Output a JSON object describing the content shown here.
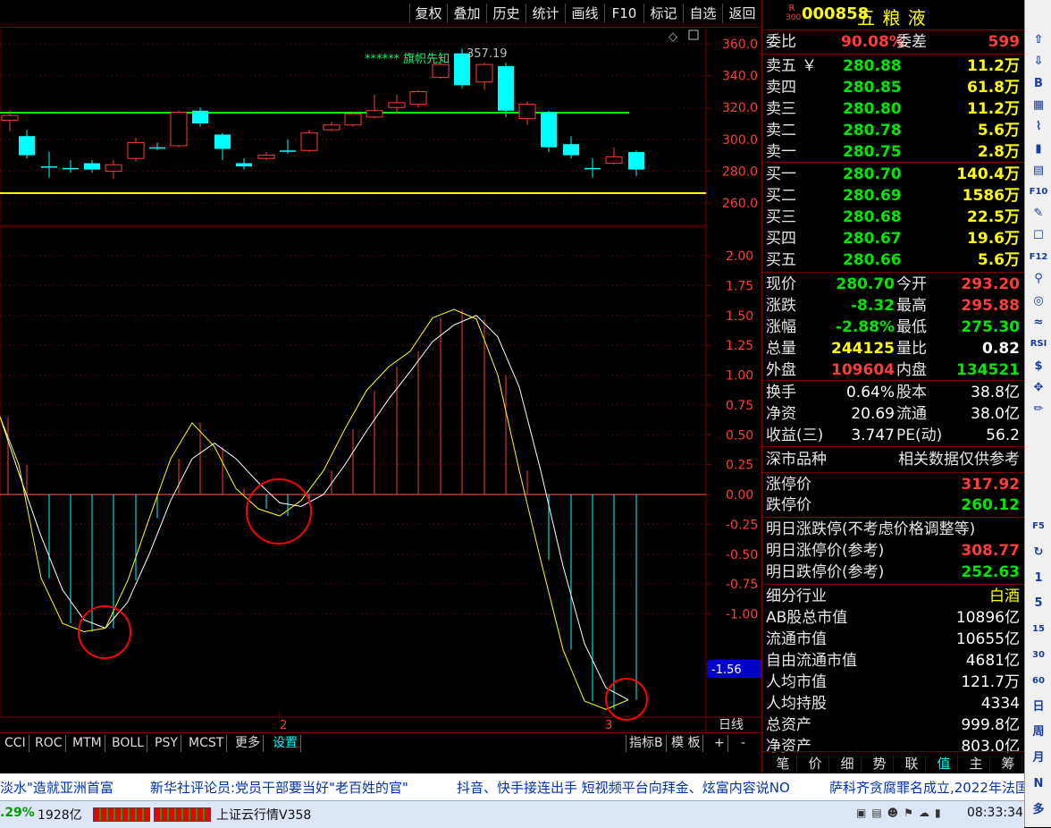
{
  "toolbar": {
    "buttons": [
      "复权",
      "叠加",
      "历史",
      "统计",
      "画线",
      "F10",
      "标记",
      "自选",
      "返回"
    ]
  },
  "price_axis": {
    "labels": [
      "360.0",
      "340.0",
      "320.0",
      "300.0",
      "280.0",
      "260.0"
    ],
    "annotation_high": "357.19",
    "annotation_flag": "****** 旗帜先知"
  },
  "indicator_axis": {
    "labels": [
      "2.00",
      "1.75",
      "1.50",
      "1.25",
      "1.00",
      "0.75",
      "0.50",
      "0.25",
      "0.00",
      "-0.25",
      "-0.50",
      "-0.75",
      "-1.00"
    ],
    "current_value": "-1.56"
  },
  "date_markers": {
    "m2": "2",
    "m3": "3"
  },
  "period_label": "日线",
  "indicator_tabs": [
    "CCI",
    "ROC",
    "MTM",
    "BOLL",
    "PSY",
    "MCST",
    "更多",
    "设置"
  ],
  "right_tabs": {
    "indicator": "指标B",
    "template": "模 板",
    "plus": "+",
    "minus": "-"
  },
  "stock": {
    "badge_top": "R",
    "badge_bottom": "300",
    "code": "000858",
    "name": "五 粮 液"
  },
  "quote": {
    "weibi_label": "委比",
    "weibi_value": "90.08%",
    "weicha_label": "委差",
    "weicha_value": "599",
    "asks": [
      {
        "label": "卖五",
        "price": "280.88",
        "vol": "11.2万"
      },
      {
        "label": "卖四",
        "price": "280.85",
        "vol": "61.8万"
      },
      {
        "label": "卖三",
        "price": "280.80",
        "vol": "11.2万"
      },
      {
        "label": "卖二",
        "price": "280.78",
        "vol": "5.6万"
      },
      {
        "label": "卖一",
        "price": "280.75",
        "vol": "2.8万"
      }
    ],
    "bids": [
      {
        "label": "买一",
        "price": "280.70",
        "vol": "140.4万"
      },
      {
        "label": "买二",
        "price": "280.69",
        "vol": "1586万"
      },
      {
        "label": "买三",
        "price": "280.68",
        "vol": "22.5万"
      },
      {
        "label": "买四",
        "price": "280.67",
        "vol": "19.6万"
      },
      {
        "label": "买五",
        "price": "280.66",
        "vol": "5.6万"
      }
    ],
    "stats": [
      {
        "l1": "现价",
        "v1": "280.70",
        "l2": "今开",
        "v2": "293.20"
      },
      {
        "l1": "涨跌",
        "v1": "-8.32",
        "l2": "最高",
        "v2": "295.88"
      },
      {
        "l1": "涨幅",
        "v1": "-2.88%",
        "l2": "最低",
        "v2": "275.30"
      },
      {
        "l1": "总量",
        "v1": "244125",
        "l2": "量比",
        "v2": "0.82"
      },
      {
        "l1": "外盘",
        "v1": "109604",
        "l2": "内盘",
        "v2": "134521"
      }
    ],
    "fund": [
      {
        "l1": "换手",
        "v1": "0.64%",
        "l2": "股本",
        "v2": "38.8亿"
      },
      {
        "l1": "净资",
        "v1": "20.69",
        "l2": "流通",
        "v2": "38.0亿"
      },
      {
        "l1": "收益(三)",
        "v1": "3.747",
        "l2": "PE(动)",
        "v2": "56.2"
      }
    ],
    "market_label": "深市品种",
    "market_note": "相关数据仅供参考",
    "limit_up_label": "涨停价",
    "limit_up": "317.92",
    "limit_down_label": "跌停价",
    "limit_down": "260.12",
    "next_title": "明日涨跌停(不考虑价格调整等)",
    "next_up_label": "明日涨停价(参考)",
    "next_up": "308.77",
    "next_down_label": "明日跌停价(参考)",
    "next_down": "252.63",
    "industry_label": "细分行业",
    "industry": "白酒",
    "values": [
      {
        "label": "AB股总市值",
        "value": "10896亿"
      },
      {
        "label": "流通市值",
        "value": "10655亿"
      },
      {
        "label": "自由流通市值",
        "value": "4681亿"
      },
      {
        "label": "人均市值",
        "value": "121.7万"
      },
      {
        "label": "人均持股",
        "value": "4334"
      },
      {
        "label": "总资产",
        "value": "999.8亿"
      },
      {
        "label": "净资产",
        "value": "803.0亿"
      }
    ],
    "sub_tabs": [
      "笔",
      "价",
      "细",
      "势",
      "联",
      "值",
      "主",
      "筹"
    ]
  },
  "sidebar_icons": [
    "⇧",
    "⇩",
    "B",
    "▦",
    "⌇",
    "▮",
    "▤",
    "F10",
    "✎",
    "☐",
    "F12",
    "⚲",
    "◎",
    "≈",
    "RSI",
    "$",
    "✥",
    "✏",
    "F5",
    "↻",
    "1",
    "5",
    "15",
    "30",
    "60",
    "日",
    "周",
    "月",
    "N",
    "多"
  ],
  "news": [
    "淡水\"造就亚洲首富",
    "新华社评论员:党员干部要当好\"老百姓的官\"",
    "抖音、快手接连出手 短视频平台向拜金、炫富内容说NO",
    "萨科齐贪腐罪名成立,2022年法国"
  ],
  "status": {
    "change": ".29%",
    "amount": "1928亿",
    "service": "上证云行情V358",
    "time": "08:33:34"
  },
  "colors": {
    "up": "#ff3c3c",
    "down": "#00ffff",
    "green_line": "#00ff00",
    "yellow_line": "#ffff00",
    "fast_line": "#ffff00",
    "slow_line": "#ffffff",
    "grid": "#7a0000"
  }
}
